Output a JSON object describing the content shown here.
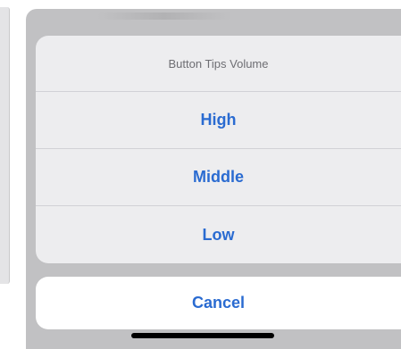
{
  "action_sheet": {
    "title": "Button Tips Volume",
    "options": [
      {
        "label": "High"
      },
      {
        "label": "Middle"
      },
      {
        "label": "Low"
      }
    ],
    "cancel_label": "Cancel"
  },
  "colors": {
    "accent": "#2a6bd1",
    "sheet_background": "#ededef",
    "backdrop": "#c1c1c3"
  }
}
